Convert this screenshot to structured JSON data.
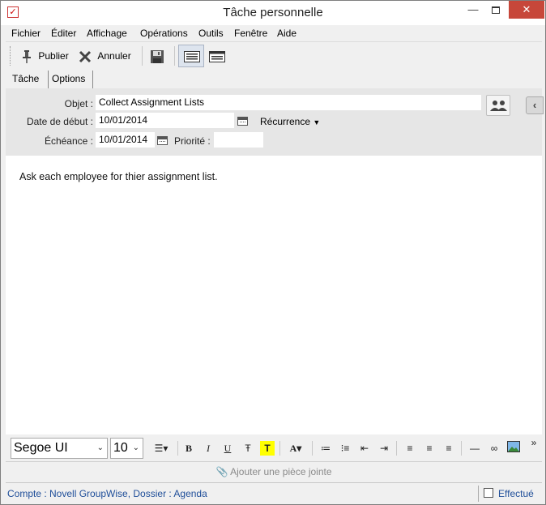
{
  "window": {
    "title": "Tâche personnelle",
    "min_glyph": "—",
    "close_glyph": "✕"
  },
  "menu": [
    "Fichier",
    "Éditer",
    "Affichage",
    "Opérations",
    "Outils",
    "Fenêtre",
    "Aide"
  ],
  "toolbar": {
    "post_label": "Publier",
    "cancel_label": "Annuler"
  },
  "tabs": {
    "task": "Tâche",
    "options": "Options"
  },
  "form": {
    "subject_label": "Objet :",
    "subject_value": "Collect Assignment Lists",
    "start_label": "Date de début :",
    "start_value": "10/01/2014",
    "recurrence_label": "Récurrence",
    "due_label": "Échéance :",
    "due_value": "10/01/2014",
    "priority_label": "Priorité :",
    "priority_value": ""
  },
  "body": {
    "text": "Ask each employee for thier assignment list."
  },
  "format": {
    "font": "Segoe UI",
    "size": "10",
    "bold": "B",
    "italic": "I",
    "underline": "U",
    "strike": "Ŧ",
    "highlight": "T",
    "more": "»"
  },
  "attach": {
    "label": "Ajouter une pièce jointe"
  },
  "status": {
    "account": "Compte : Novell GroupWise,  Dossier : Agenda",
    "done_label": "Effectué"
  },
  "colors": {
    "close_button": "#c7473a",
    "status_text": "#1f4e99",
    "highlight": "#ffff00"
  }
}
